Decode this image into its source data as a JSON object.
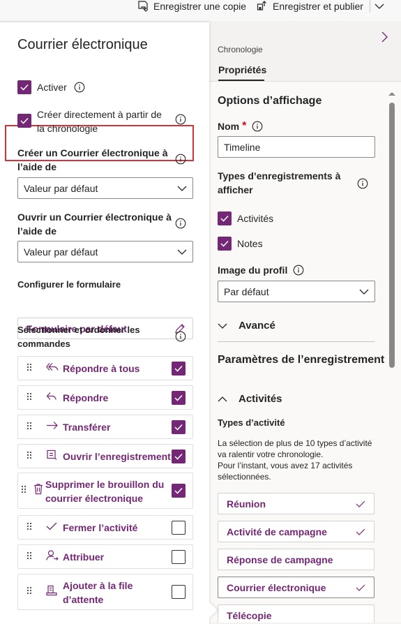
{
  "colors": {
    "accent": "#742774",
    "highlight_border": "#d13438"
  },
  "toolbar": {
    "save_copy_label": "Enregistrer une copie",
    "save_publish_label": "Enregistrer et publier"
  },
  "flyout": {
    "title": "Courrier électronique",
    "enable_label": "Activer",
    "create_from_timeline_line1": "Créer directement à partir de",
    "create_from_timeline_line2": "la chronologie",
    "create_using_line1": "Créer un Courrier électronique à",
    "create_using_line2": "l’aide de",
    "create_using_value": "Valeur par défaut",
    "open_using_line1": "Ouvrir un Courrier électronique à",
    "open_using_line2": "l’aide de",
    "open_using_value": "Valeur par défaut",
    "configure_form_label": "Configurer le formulaire",
    "form_value": "Formulaire par défaut",
    "select_commands_line1": "Sélectionner et ordonner les",
    "select_commands_line2": "commandes",
    "commands": [
      {
        "line1": "Répondre à tous",
        "line2": "",
        "checked": true,
        "icon": "reply-all-icon"
      },
      {
        "line1": "Répondre",
        "line2": "",
        "checked": true,
        "icon": "reply-icon"
      },
      {
        "line1": "Transférer",
        "line2": "",
        "checked": true,
        "icon": "forward-arrow-icon"
      },
      {
        "line1": "Ouvrir l’enregistrement",
        "line2": "",
        "checked": true,
        "icon": "open-record-icon"
      },
      {
        "line1": "Supprimer le brouillon du",
        "line2": "courrier électronique",
        "checked": true,
        "icon": "trash-icon"
      },
      {
        "line1": "Fermer l’activité",
        "line2": "",
        "checked": false,
        "icon": "checkmark-icon"
      },
      {
        "line1": "Attribuer",
        "line2": "",
        "checked": false,
        "icon": "person-assign-icon"
      },
      {
        "line1": "Ajouter à la file",
        "line2": "d’attente",
        "checked": false,
        "icon": "queue-icon"
      }
    ]
  },
  "properties": {
    "breadcrumb": "Chronologie",
    "tab_label": "Propriétés",
    "display_options_title": "Options d’affichage",
    "name_label": "Nom",
    "required_mark": "*",
    "name_value": "Timeline",
    "record_types_line1": "Types d’enregistrements à",
    "record_types_line2": "afficher",
    "activities_label": "Activités",
    "notes_label": "Notes",
    "profile_image_label": "Image du profil",
    "profile_image_value": "Par défaut",
    "advanced_label": "Avancé",
    "record_settings_title": "Paramètres de l’enregistrement",
    "activities_section_label": "Activités",
    "activity_types_label": "Types d’activité",
    "warning_line1": "La sélection de plus de 10 types d’activité",
    "warning_line2": "va ralentir votre chronologie.",
    "warning_line3": "Pour l’instant, vous avez 17 activités",
    "warning_line4": "sélectionnées.",
    "activity_types": [
      {
        "label": "Réunion",
        "checked": true
      },
      {
        "label": "Activité de campagne",
        "checked": true
      },
      {
        "label": "Réponse de campagne",
        "checked": false
      },
      {
        "label": "Courrier électronique",
        "checked": true
      },
      {
        "label": "Télécopie",
        "checked": false
      }
    ]
  }
}
